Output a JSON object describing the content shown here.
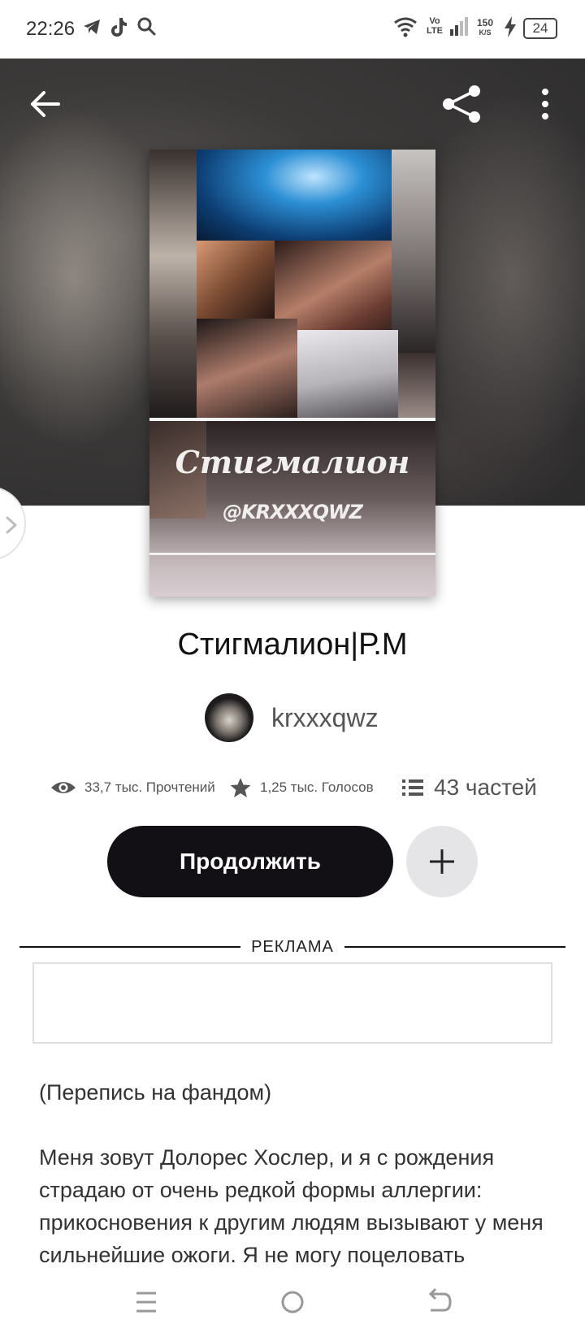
{
  "status_bar": {
    "time": "22:26",
    "signal_label_top": "Vo",
    "signal_label_bottom": "LTE",
    "speed_top": "150",
    "speed_bottom": "K/S",
    "battery": "24"
  },
  "header": {
    "back_icon": "arrow-left-icon",
    "share_icon": "share-icon",
    "more_icon": "more-vertical-icon"
  },
  "cover": {
    "title": "Стигмалион",
    "handle": "@KRXXXQWZ"
  },
  "story": {
    "title": "Стигмалион|Р.М",
    "author": "krxxxqwz",
    "reads": "33,7 тыс. Прочтений",
    "votes": "1,25 тыс. Голосов",
    "parts": "43 частей"
  },
  "actions": {
    "continue_label": "Продолжить",
    "add_icon": "plus-icon"
  },
  "ad": {
    "label": "РЕКЛАМА"
  },
  "description": {
    "line1": "(Перепись на фандом)",
    "line2": "Меня зовут Долорес Хослер, и я с рождения страдаю от очень редкой формы аллергии: прикосновения к другим людям вызывают у меня сильнейшие ожоги. Я не могу поцеловать"
  },
  "colors": {
    "primary_button": "#121014",
    "secondary_button": "#e5e4e6",
    "text_muted": "#555555"
  }
}
